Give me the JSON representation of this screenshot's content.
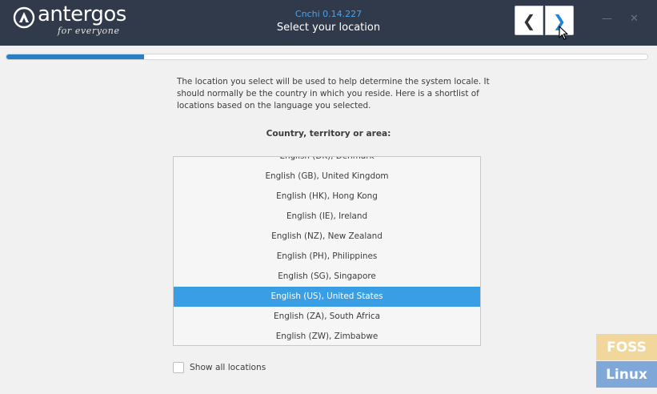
{
  "brand": {
    "wordmark": "antergos",
    "tagline": "for everyone"
  },
  "app": {
    "version_line": "Cnchi  0.14.227",
    "subtitle": "Select your location"
  },
  "nav": {
    "back_glyph": "❮",
    "forward_glyph": "❯",
    "back_icon": "chevron-left-icon",
    "forward_icon": "chevron-right-icon"
  },
  "window_controls": {
    "minimize_glyph": "—",
    "close_glyph": "✕"
  },
  "progress": {
    "fraction": 0.215,
    "fill_color": "#2b7fc4"
  },
  "description": "The location you select will be used to help determine the system locale. It should normally be the country in which you reside. Here is a shortlist of locations based on the language you selected.",
  "field_label": "Country, territory or area:",
  "locations": [
    {
      "label": "English (DK), Denmark",
      "selected": false
    },
    {
      "label": "English (GB), United Kingdom",
      "selected": false
    },
    {
      "label": "English (HK), Hong Kong",
      "selected": false
    },
    {
      "label": "English (IE), Ireland",
      "selected": false
    },
    {
      "label": "English (NZ), New Zealand",
      "selected": false
    },
    {
      "label": "English (PH), Philippines",
      "selected": false
    },
    {
      "label": "English (SG), Singapore",
      "selected": false
    },
    {
      "label": "English (US), United States",
      "selected": true
    },
    {
      "label": "English (ZA), South Africa",
      "selected": false
    },
    {
      "label": "English (ZW), Zimbabwe",
      "selected": false
    }
  ],
  "show_all": {
    "label": "Show all locations",
    "checked": false
  },
  "watermark": {
    "line1": "FOSS",
    "line2": "Linux"
  },
  "colors": {
    "header_bg": "#313a4a",
    "accent": "#3a9ee5",
    "version_text": "#4aa3ea"
  }
}
